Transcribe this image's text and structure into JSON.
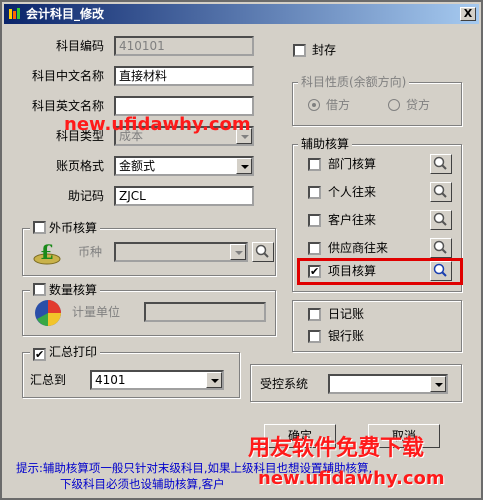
{
  "window": {
    "title": "会计科目_修改",
    "close_label": "X"
  },
  "form": {
    "code_label": "科目编码",
    "code_value": "410101",
    "cn_name_label": "科目中文名称",
    "cn_name_value": "直接材料",
    "en_name_label": "科目英文名称",
    "en_name_value": "",
    "type_label": "科目类型",
    "type_value": "成本",
    "page_format_label": "账页格式",
    "page_format_value": "金额式",
    "mnemonic_label": "助记码",
    "mnemonic_value": "ZJCL"
  },
  "foreign": {
    "label": "外币核算",
    "currency_label": "币种",
    "currency_value": "",
    "checked": false
  },
  "quantity": {
    "label": "数量核算",
    "unit_label": "计量单位",
    "unit_value": "",
    "checked": false
  },
  "summary": {
    "label": "汇总打印",
    "checked": true,
    "to_label": "汇总到",
    "to_value": "4101"
  },
  "seal": {
    "label": "封存",
    "checked": false
  },
  "nature": {
    "title": "科目性质(余额方向)",
    "debit": "借方",
    "credit": "贷方",
    "selected": "debit"
  },
  "aux": {
    "title": "辅助核算",
    "items": [
      {
        "label": "部门核算",
        "checked": false
      },
      {
        "label": "个人往来",
        "checked": false
      },
      {
        "label": "客户往来",
        "checked": false
      },
      {
        "label": "供应商往来",
        "checked": false
      },
      {
        "label": "项目核算",
        "checked": true
      }
    ]
  },
  "ledger": {
    "daily_label": "日记账",
    "bank_label": "银行账"
  },
  "control": {
    "label": "受控系统",
    "value": ""
  },
  "buttons": {
    "ok": "确定",
    "cancel": "取消"
  },
  "hint": {
    "line1": "提示:辅助核算项一般只针对末级科目,如果上级科目也想设置辅助核算,",
    "line2": "下级科目必须也设辅助核算,客户"
  },
  "watermarks": {
    "top": "new.ufidawhy.com",
    "brand": "用友软件免费下载",
    "bottom": "new.ufidawhy.com"
  },
  "colors": {
    "title_bar": "#0a246a",
    "highlight": "#e00000",
    "watermark": "#ff1a1a",
    "hint": "#0000cc"
  }
}
